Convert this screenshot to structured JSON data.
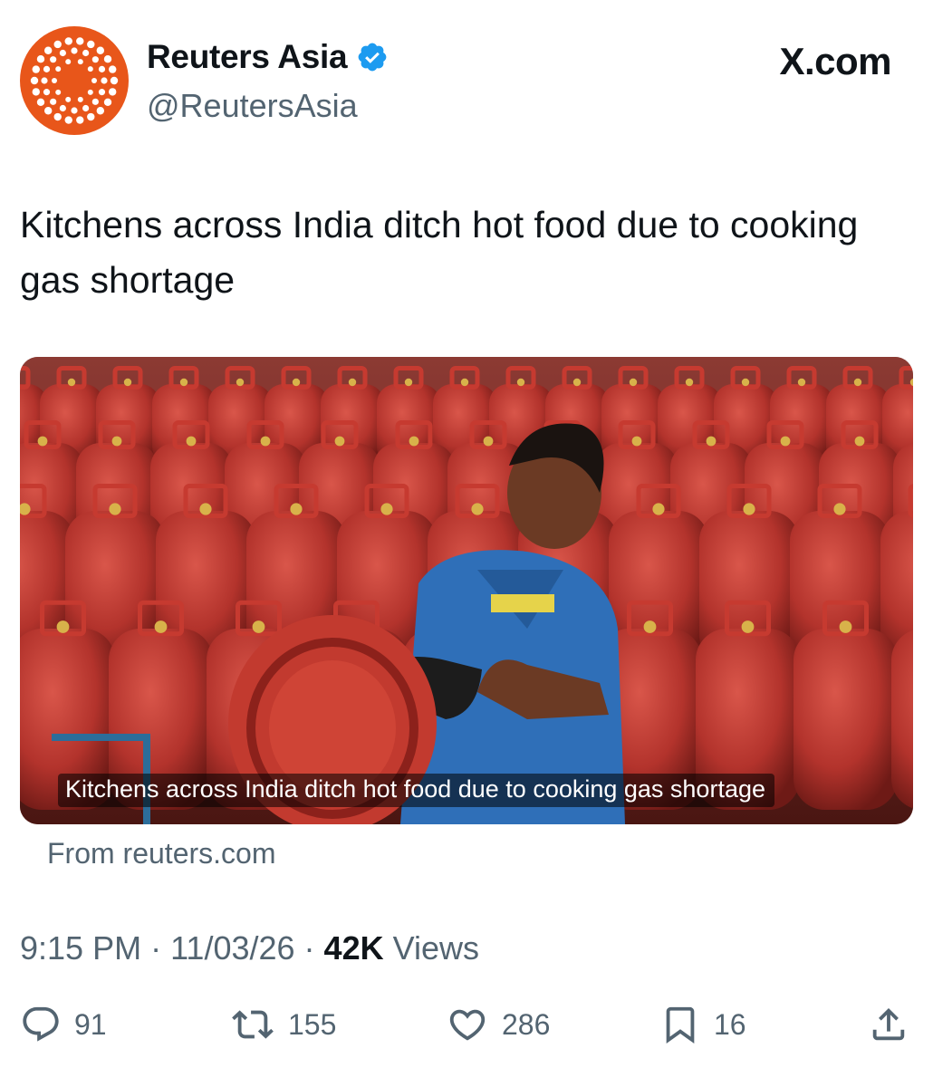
{
  "account": {
    "display_name": "Reuters Asia",
    "handle": "@ReutersAsia",
    "verified": true,
    "avatar_color": "#e8561a",
    "verified_color": "#1d9bf0"
  },
  "brand": {
    "label": "X.com",
    "icon": "x-logo-icon"
  },
  "tweet": {
    "text": "Kitchens across India ditch hot food due to cooking gas shortage"
  },
  "card": {
    "caption": "Kitchens across India ditch hot food due to cooking gas shortage",
    "source": "From reuters.com"
  },
  "meta": {
    "time": "9:15 PM",
    "separator": "·",
    "date": "11/03/26",
    "views_count": "42K",
    "views_label": "Views"
  },
  "actions": {
    "replies": {
      "icon": "reply-icon",
      "count": "91"
    },
    "reposts": {
      "icon": "repost-icon",
      "count": "155"
    },
    "likes": {
      "icon": "heart-icon",
      "count": "286"
    },
    "bookmarks": {
      "icon": "bookmark-icon",
      "count": "16"
    },
    "share": {
      "icon": "share-icon"
    }
  }
}
